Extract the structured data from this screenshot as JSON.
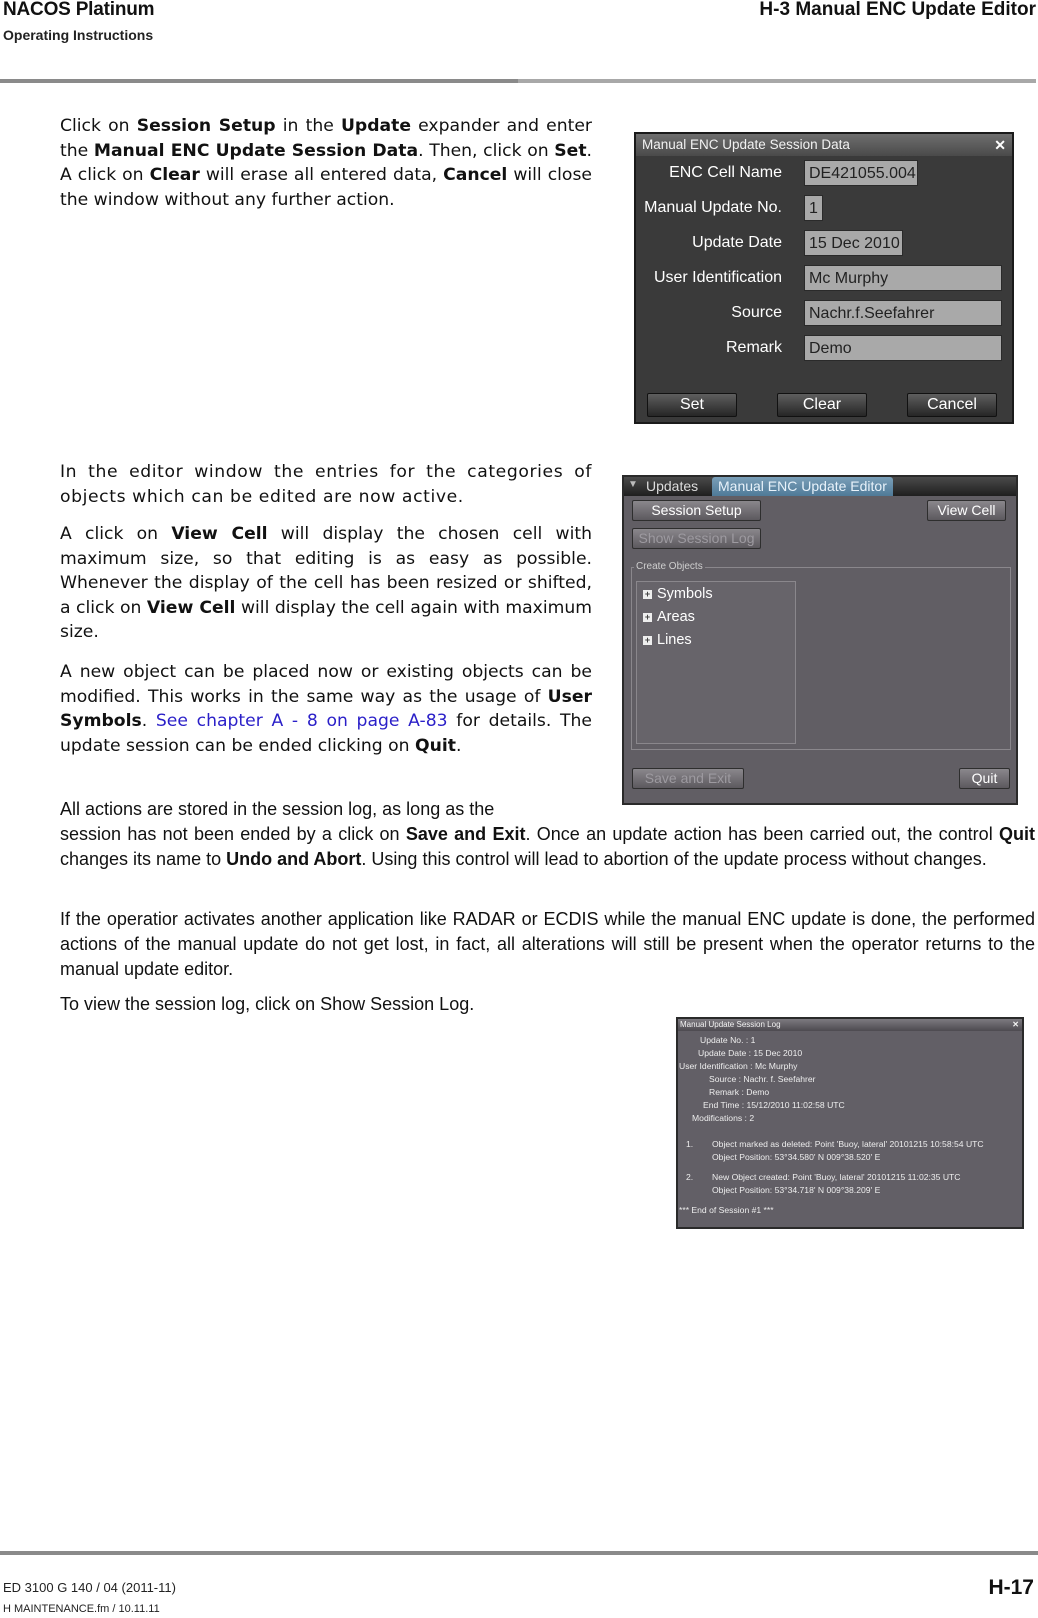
{
  "header": {
    "product": "NACOS Platinum",
    "subtitle": "Operating Instructions",
    "section": "H-3  Manual ENC Update Editor"
  },
  "footer": {
    "doc_id": "ED 3100 G 140 / 04 (2011-11)",
    "file": "H MAINTENANCE.fm / 10.11.11",
    "page": "H-17"
  },
  "body": {
    "p1": {
      "t1": "Click on ",
      "b1": "Session Setup",
      "t2": " in the ",
      "b2": "Update",
      "t3": " expander and enter the ",
      "b3": "Manual ENC Update Session Data",
      "t4": ". Then, click on ",
      "b4": "Set",
      "t5": ". A click on ",
      "b5": "Clear",
      "t6": " will erase all entered data, ",
      "b6": "Cancel",
      "t7": " will close the window without any further action."
    },
    "p2": "In the editor window the entries for the categories of objects which can be edited are now active.",
    "p3": {
      "t1": "A click on ",
      "b1": "View Cell",
      "t2": " will display the chosen cell with maximum size, so that editing is as easy as possible. Whenever the display of the cell has been resized or shifted, a click on ",
      "b2": "View Cell",
      "t3": " will display the cell again with maximum size."
    },
    "p4": {
      "t1": "A new object can be placed now or existing objects can be modified. This works in the same way as the usage of ",
      "b1": "User Symbols",
      "t2": ". ",
      "link": "See chapter A - 8 on page A-83",
      "t3": " for details. The update session can be ended clicking on ",
      "b2": "Quit",
      "t4": "."
    },
    "p5": {
      "t0": "All actions are stored in the session log, as long as the",
      "t1": "session has not been ended by a click on ",
      "b1": "Save and Exit",
      "t2": ". Once an update action has been carried out, the control ",
      "b2": "Quit",
      "t3": " changes its name to ",
      "b3": "Undo and Abort",
      "t4": ". Using this control will lead to abortion of the update process without changes."
    },
    "p6": "If the operatior activates another application like RADAR or ECDIS while the manual ENC update is done, the performed actions of the manual update do not get lost, in fact, all alterations will still be present when the operator returns to the manual update editor.",
    "p7": "To view the session log, click on Show Session Log."
  },
  "session_dialog": {
    "title": "Manual ENC Update Session Data",
    "close_icon": "close-icon",
    "fields": [
      {
        "label": "ENC Cell Name",
        "value": "DE421055.004"
      },
      {
        "label": "Manual Update No.",
        "value": "1"
      },
      {
        "label": "Update Date",
        "value": "15 Dec 2010"
      },
      {
        "label": "User Identification",
        "value": "Mc Murphy"
      },
      {
        "label": "Source",
        "value": "Nachr.f.Seefahrer"
      },
      {
        "label": "Remark",
        "value": "Demo"
      }
    ],
    "buttons": {
      "set": "Set",
      "clear": "Clear",
      "cancel": "Cancel"
    }
  },
  "editor": {
    "tabs": {
      "updates": "Updates",
      "active": "Manual ENC Update Editor"
    },
    "buttons": {
      "session_setup": "Session Setup",
      "view_cell": "View Cell",
      "show_session_log": "Show Session Log",
      "save_and_exit": "Save and Exit",
      "quit": "Quit"
    },
    "group_label": "Create Objects",
    "tree": [
      "Symbols",
      "Areas",
      "Lines"
    ]
  },
  "session_log": {
    "title": "Manual Update Session Log",
    "header_lines": [
      "Update No. : 1",
      "Update Date : 15 Dec 2010",
      "User Identification : Mc Murphy",
      "Source : Nachr. f. Seefahrer",
      "Remark : Demo",
      "End Time : 15/12/2010 11:02:58 UTC",
      "Modifications : 2"
    ],
    "entries": [
      {
        "num": "1.",
        "line1": "Object marked as deleted: Point 'Buoy, lateral' 20101215 10:58:54 UTC",
        "line2": "Object Position: 53°34.580' N  009°38.520' E"
      },
      {
        "num": "2.",
        "line1": "New Object created: Point 'Buoy, lateral' 20101215 11:02:35 UTC",
        "line2": "Object Position: 53°34.718' N  009°38.209' E"
      }
    ],
    "end": "*** End of Session #1 ***"
  }
}
